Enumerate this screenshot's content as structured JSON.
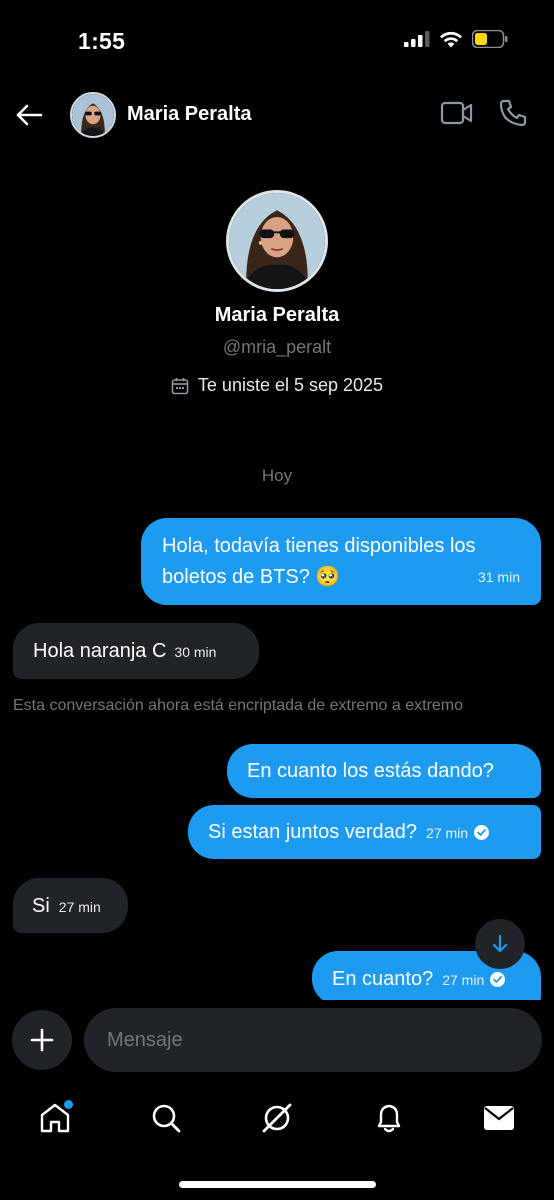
{
  "status_bar": {
    "time": "1:55",
    "battery_color": "#ffd60a"
  },
  "header": {
    "name": "Maria Peralta",
    "icons": {
      "back": "arrow-left-icon",
      "video": "video-camera-icon",
      "call": "phone-icon"
    }
  },
  "profile": {
    "name": "Maria Peralta",
    "handle": "@mria_peralt",
    "joined": "Te uniste el 5 sep 2025"
  },
  "conversation": {
    "day_label": "Hoy",
    "messages": [
      {
        "direction": "out",
        "text_line1": "Hola, todavía tienes disponibles los",
        "text_line2": "boletos de BTS? 🥺",
        "time": "31 min"
      },
      {
        "direction": "in",
        "text": "Hola naranja C",
        "time": "30 min"
      },
      {
        "direction": "out",
        "text": "En cuanto los estás dando?"
      },
      {
        "direction": "out",
        "text": "Si estan juntos verdad?",
        "time": "27 min",
        "read": true
      },
      {
        "direction": "in",
        "text": "Si",
        "time": "27 min"
      },
      {
        "direction": "out",
        "text": "En cuanto?",
        "time": "27 min",
        "read": true
      }
    ],
    "encryption_notice": "Esta conversación ahora está encriptada de extremo a extremo"
  },
  "composer": {
    "placeholder": "Mensaje"
  },
  "tabs": [
    "home-icon",
    "search-icon",
    "grok-icon",
    "notifications-icon",
    "messages-icon"
  ],
  "colors": {
    "accent": "#1d9bf0",
    "incoming_bubble": "#202327",
    "background": "#000000"
  }
}
